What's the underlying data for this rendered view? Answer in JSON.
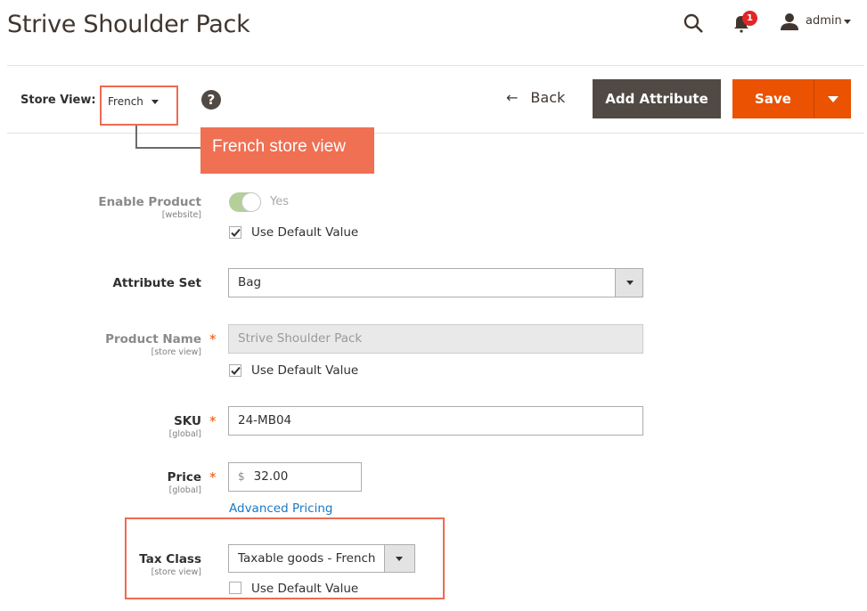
{
  "header": {
    "title": "Strive Shoulder Pack",
    "notifications_count": "1",
    "user": "admin",
    "icons": [
      "search-icon",
      "bell-icon",
      "user-icon"
    ]
  },
  "toolbar": {
    "store_view_label": "Store View:",
    "store_view_value": "French",
    "help": "?",
    "back_label": "Back",
    "back_arrow": "←",
    "add_attribute_label": "Add Attribute",
    "save_label": "Save"
  },
  "annotation": {
    "callout": "French store view",
    "color": "#f07053"
  },
  "form": {
    "enable_product": {
      "label": "Enable Product",
      "scope": "[website]",
      "value": "Yes",
      "enabled": true,
      "use_default_label": "Use Default Value",
      "use_default": true
    },
    "attribute_set": {
      "label": "Attribute Set",
      "value": "Bag"
    },
    "product_name": {
      "label": "Product Name",
      "scope": "[store view]",
      "value": "Strive Shoulder Pack",
      "required": "*",
      "use_default_label": "Use Default Value",
      "use_default": true
    },
    "sku": {
      "label": "SKU",
      "scope": "[global]",
      "value": "24-MB04",
      "required": "*"
    },
    "price": {
      "label": "Price",
      "scope": "[global]",
      "currency": "$",
      "value": "32.00",
      "required": "*",
      "advanced_link": "Advanced Pricing"
    },
    "tax_class": {
      "label": "Tax Class",
      "scope": "[store view]",
      "value": "Taxable goods - French",
      "use_default_label": "Use Default Value",
      "use_default": false
    }
  },
  "colors": {
    "accent": "#eb5202",
    "dark_button": "#514943",
    "link": "#1979c3",
    "highlight": "#ef6a51"
  }
}
